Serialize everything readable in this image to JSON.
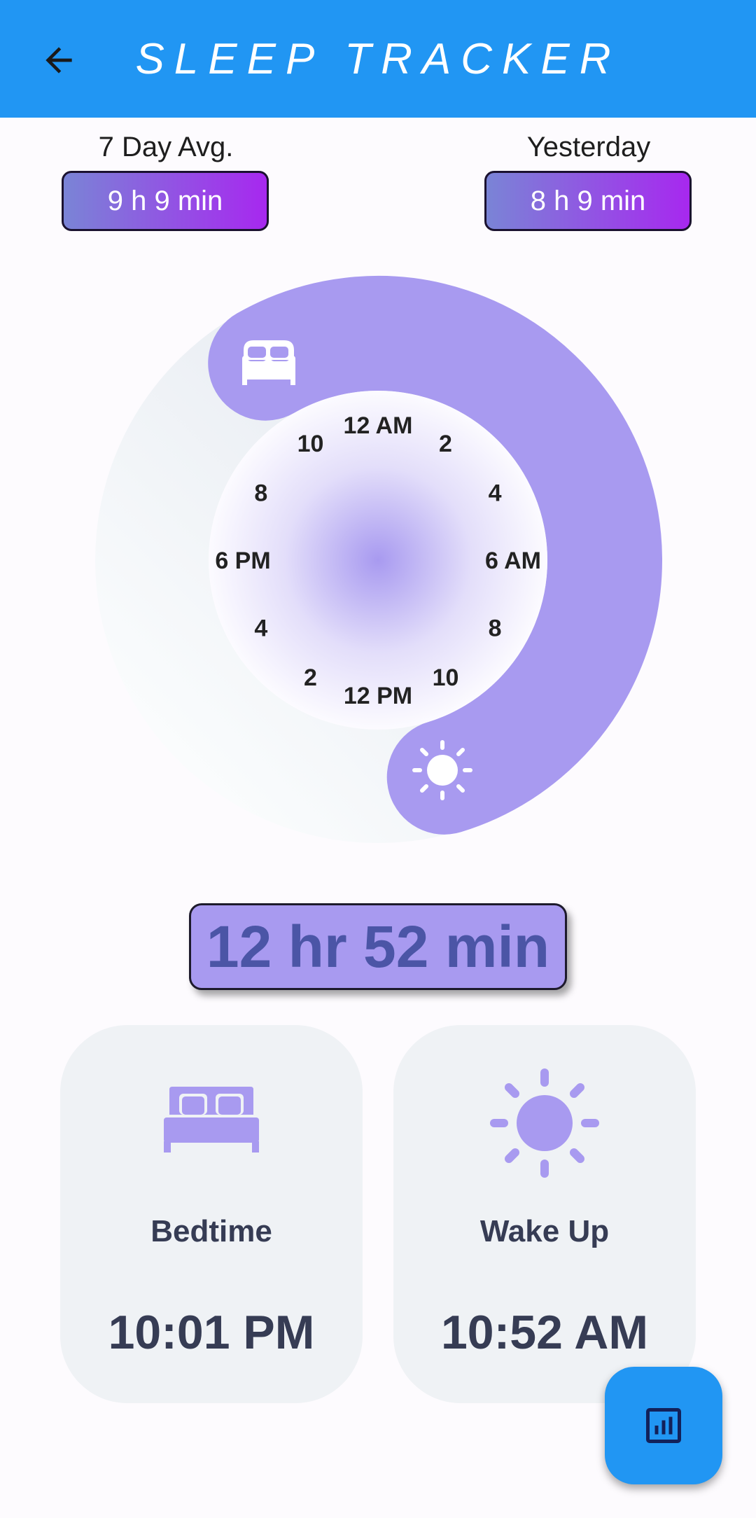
{
  "header": {
    "title": "SLEEP TRACKER",
    "back_icon": "arrow-back-icon"
  },
  "stats": {
    "avg_label": "7 Day Avg.",
    "avg_value": "9 h 9 min",
    "yesterday_label": "Yesterday",
    "yesterday_value": "8 h 9 min"
  },
  "dial": {
    "hour_labels": [
      "12 AM",
      "2",
      "4",
      "6 AM",
      "8",
      "10",
      "12 PM",
      "2",
      "4",
      "6 PM",
      "8",
      "10"
    ],
    "bedtime_icon": "bed-icon",
    "wake_icon": "sun-icon"
  },
  "duration": "12 hr 52 min",
  "bedtime_card": {
    "icon": "bed-icon",
    "title": "Bedtime",
    "time": "10:01 PM"
  },
  "wake_card": {
    "icon": "sun-icon",
    "title": "Wake Up",
    "time": "10:52 AM"
  },
  "fab": {
    "icon": "bar-chart-icon"
  },
  "colors": {
    "app_bar": "#2196f3",
    "arc": "#a89af0",
    "card_text": "#363c54",
    "duration_text": "#4b55a6",
    "pill_start": "#7a84d6",
    "pill_end": "#a728ef"
  }
}
